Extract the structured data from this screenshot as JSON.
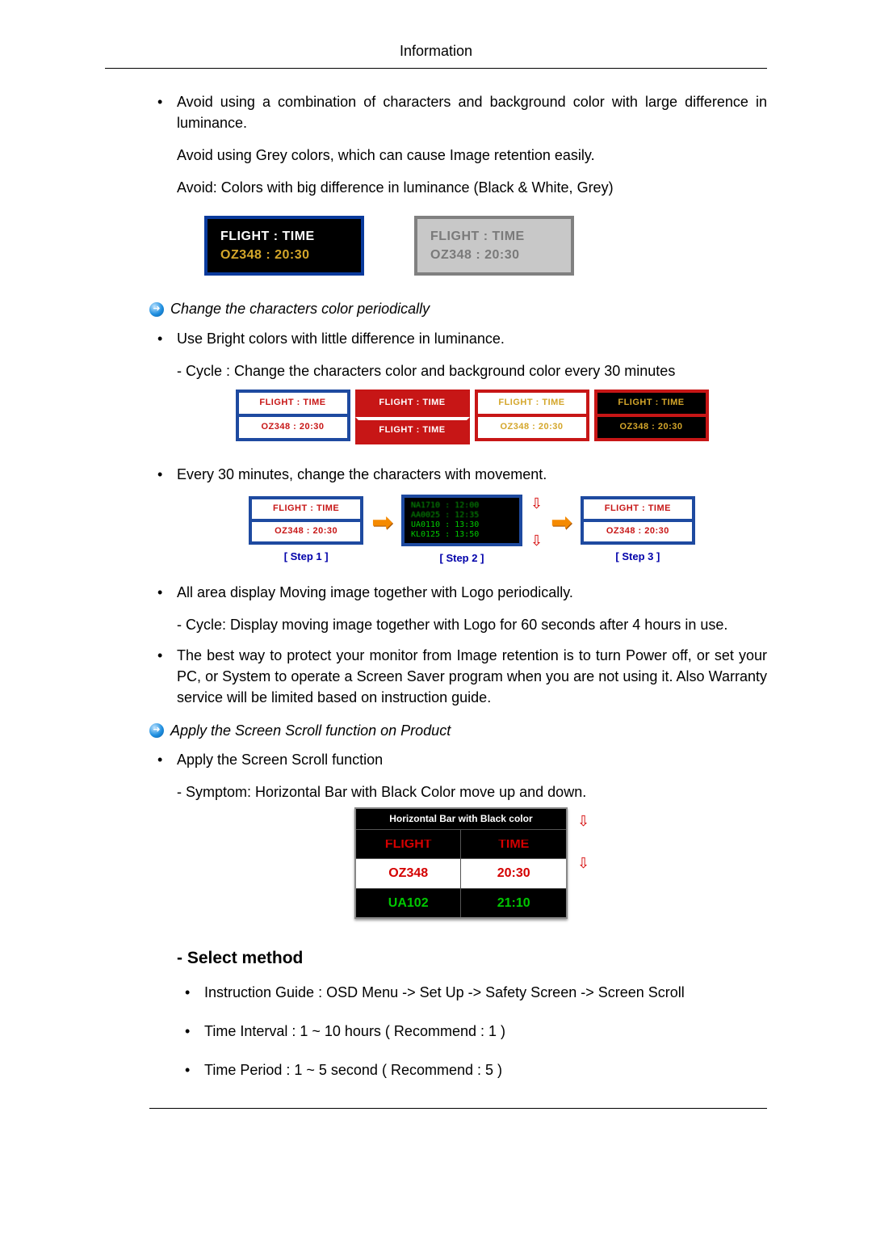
{
  "header": {
    "title": "Information"
  },
  "b1": {
    "p1": "Avoid using a combination of characters and background color with large difference in luminance.",
    "p2": "Avoid using Grey colors, which can cause Image retention easily.",
    "p3": "Avoid: Colors with big difference in luminance (Black & White, Grey)"
  },
  "fig1": {
    "dark_l1": "FLIGHT : TIME",
    "dark_l2": "OZ348   : 20:30",
    "grey_l1": "FLIGHT : TIME",
    "grey_l2": "OZ348   : 20:30"
  },
  "head1": "Change the characters color periodically",
  "b2": {
    "p1": "Use Bright colors with little difference in luminance.",
    "p2": "- Cycle : Change the characters color and background color every 30 minutes"
  },
  "fig2": {
    "t0_a": "FLIGHT : TIME",
    "t0_b": "OZ348   : 20:30",
    "t1_a": "FLIGHT : TIME",
    "t1_b": "FLIGHT : TIME",
    "t2_a": "FLIGHT : TIME",
    "t2_b": "OZ348   : 20:30",
    "t3_a": "FLIGHT : TIME",
    "t3_b": "OZ348   : 20:30"
  },
  "b3": "Every 30 minutes, change the characters with movement.",
  "fig3": {
    "s1_a": "FLIGHT : TIME",
    "s1_b": "OZ348   : 20:30",
    "scroll_a": "NA1710 : 12:00",
    "scroll_b": "AA0025 : 12:35",
    "scroll_c": "UA0110 : 13:30",
    "scroll_d": "KL0125 : 13:50",
    "s3_a": "FLIGHT : TIME",
    "s3_b": "OZ348   : 20:30",
    "step1": "[ Step 1 ]",
    "step2": "[ Step 2 ]",
    "step3": "[ Step 3 ]"
  },
  "b4": {
    "p1": "All area display Moving image together with Logo periodically.",
    "p2": "- Cycle: Display moving image together with Logo for 60 seconds after 4 hours in use."
  },
  "b5": "The best way to protect your monitor from Image retention is to turn Power off, or set your PC, or System to operate a Screen Saver program when you are not using it. Also Warranty service will be limited based on instruction guide.",
  "head2": "Apply the Screen Scroll function on Product",
  "b6": {
    "p1": "Apply the Screen Scroll function",
    "p2": "- Symptom: Horizontal Bar with Black Color move up and down."
  },
  "fig4": {
    "title": "Horizontal Bar with Black color",
    "r0a": "FLIGHT",
    "r0b": "TIME",
    "r1a": "OZ348",
    "r1b": "20:30",
    "r2a": "UA102",
    "r2b": "21:10"
  },
  "select_method": "- Select method",
  "m1": "Instruction Guide : OSD Menu -> Set Up -> Safety Screen -> Screen Scroll",
  "m2": "Time Interval : 1 ~ 10 hours ( Recommend : 1 )",
  "m3": "Time Period : 1 ~ 5 second ( Recommend : 5 )"
}
